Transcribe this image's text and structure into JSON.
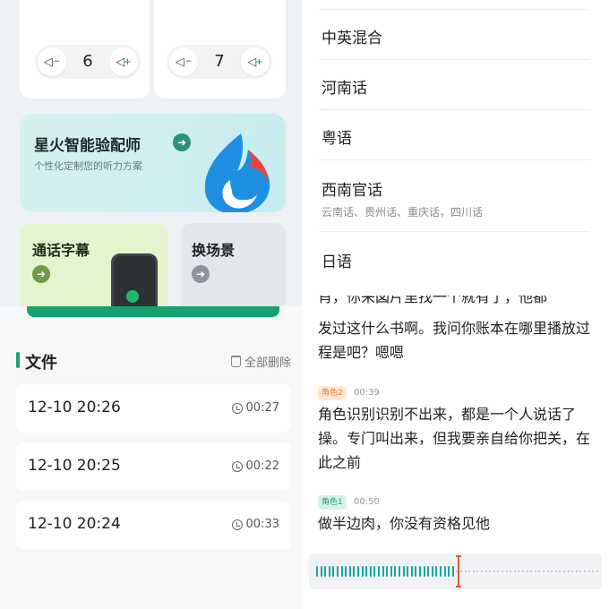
{
  "volume_cards": [
    {
      "value": "6",
      "minus_icon": "volume-down-icon",
      "plus_icon": "volume-up-icon"
    },
    {
      "value": "7",
      "minus_icon": "volume-down-icon",
      "plus_icon": "volume-up-icon"
    }
  ],
  "spark_card": {
    "title": "星火智能验配师",
    "subtitle": "个性化定制您的听力方案",
    "arrow_icon": "arrow-right-icon",
    "logo_icon": "spark-logo-icon"
  },
  "subtitle_card": {
    "title": "通话字幕",
    "arrow_icon": "arrow-right-icon",
    "image": "phone-call-icon"
  },
  "scene_card": {
    "title": "换场景",
    "arrow_icon": "arrow-right-icon"
  },
  "files": {
    "title": "文件",
    "delete_all": "全部删除",
    "items": [
      {
        "date": "12-10 20:26",
        "duration": "00:27"
      },
      {
        "date": "12-10 20:25",
        "duration": "00:22"
      },
      {
        "date": "12-10 20:24",
        "duration": "00:33"
      }
    ]
  },
  "languages": [
    {
      "name": "中英混合",
      "sub": ""
    },
    {
      "name": "河南话",
      "sub": ""
    },
    {
      "name": "粤语",
      "sub": ""
    },
    {
      "name": "西南官话",
      "sub": "云南话、贵州话、重庆话，四川话"
    },
    {
      "name": "日语",
      "sub": ""
    }
  ],
  "transcript": {
    "partial_line": "肖，你来図片里找一个就有了，他都",
    "segments": [
      {
        "role": "",
        "time": "",
        "text": "发过这什么书啊。我问你账本在哪里播放过程是吧？嗯嗯"
      },
      {
        "role": "角色2",
        "time": "00:39",
        "text": "角色识别识别不出来，都是一个人说话了操。专门叫出来，但我要亲自给你把关，在此之前"
      },
      {
        "role": "角色1",
        "time": "00:50",
        "text": "做半边肉，你没有资格见他"
      }
    ]
  },
  "waveform": {
    "progress": 0.5
  },
  "colors": {
    "accent": "#16a26f",
    "role2": "#e0833a",
    "role1": "#1aa675",
    "cursor": "#e85b3b"
  }
}
